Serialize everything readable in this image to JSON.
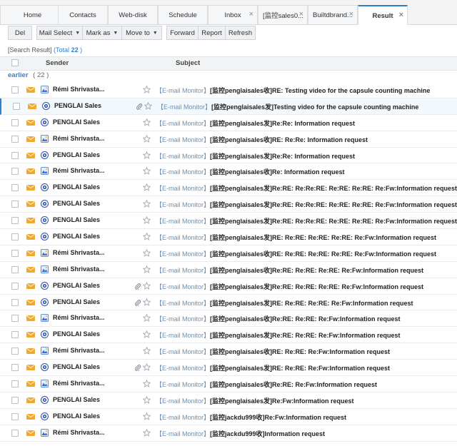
{
  "tabs": [
    {
      "label": "Home",
      "active": false,
      "closable": false
    },
    {
      "label": "Contacts",
      "active": false,
      "closable": false
    },
    {
      "label": "Web-disk",
      "active": false,
      "closable": false
    },
    {
      "label": "Schedule",
      "active": false,
      "closable": false
    },
    {
      "label": "Inbox",
      "active": false,
      "closable": true
    },
    {
      "label": "[监控sales0...",
      "active": false,
      "closable": true
    },
    {
      "label": "Builtdbrand...",
      "active": false,
      "closable": true
    },
    {
      "label": "Result",
      "active": true,
      "closable": true
    }
  ],
  "toolbar": {
    "del": "Del",
    "mail_select": "Mail Select",
    "mark_as": "Mark as",
    "move_to": "Move to",
    "forward": "Forward",
    "report": "Report",
    "refresh": "Refresh"
  },
  "search": {
    "label": "[Search Result]",
    "total_label": "Total",
    "total": "22"
  },
  "columns": {
    "sender": "Sender",
    "subject": "Subject"
  },
  "group": {
    "label": "earlier",
    "count": "( 22 )"
  },
  "monitor_tag": "【E-mail Monitor】",
  "colors": {
    "accent": "#2f7fd1",
    "envelope": "#f0a830",
    "remi_avatar": "#3b6fd8",
    "penglai_avatar": "#2a4fa8"
  },
  "emails": [
    {
      "sender": "Rémi Shrivasta...",
      "avatar": "remi",
      "attach": false,
      "selected": false,
      "subject": "[监控penglaisales收]RE: Testing video for the capsule counting machine"
    },
    {
      "sender": "PENGLAI Sales",
      "avatar": "penglai",
      "attach": true,
      "selected": true,
      "subject": "[监控penglaisales发]Testing video for the capsule counting machine"
    },
    {
      "sender": "PENGLAI Sales",
      "avatar": "penglai",
      "attach": false,
      "selected": false,
      "subject": "[监控penglaisales发]Re:Re: Information request"
    },
    {
      "sender": "Rémi Shrivasta...",
      "avatar": "remi",
      "attach": false,
      "selected": false,
      "subject": "[监控penglaisales收]RE: Re:Re: Information request"
    },
    {
      "sender": "PENGLAI Sales",
      "avatar": "penglai",
      "attach": false,
      "selected": false,
      "subject": "[监控penglaisales发]Re:Re: Information request"
    },
    {
      "sender": "Rémi Shrivasta...",
      "avatar": "remi",
      "attach": false,
      "selected": false,
      "subject": "[监控penglaisales收]Re: Information request"
    },
    {
      "sender": "PENGLAI Sales",
      "avatar": "penglai",
      "attach": false,
      "selected": false,
      "subject": "[监控penglaisales发]Re:RE: Re:Re:RE: Re:RE: Re:RE: Re:Fw:Information request"
    },
    {
      "sender": "PENGLAI Sales",
      "avatar": "penglai",
      "attach": false,
      "selected": false,
      "subject": "[监控penglaisales发]Re:RE: Re:Re:RE: Re:RE: Re:RE: Re:Fw:Information request"
    },
    {
      "sender": "PENGLAI Sales",
      "avatar": "penglai",
      "attach": false,
      "selected": false,
      "subject": "[监控penglaisales发]Re:RE: Re:Re:RE: Re:RE: Re:RE: Re:Fw:Information request"
    },
    {
      "sender": "PENGLAI Sales",
      "avatar": "penglai",
      "attach": false,
      "selected": false,
      "subject": "[监控penglaisales发]RE: Re:RE: Re:RE: Re:RE: Re:Fw:Information request"
    },
    {
      "sender": "Rémi Shrivasta...",
      "avatar": "remi",
      "attach": false,
      "selected": false,
      "subject": "[监控penglaisales收]RE: Re:RE: Re:RE: Re:RE: Re:Fw:Information request"
    },
    {
      "sender": "Rémi Shrivasta...",
      "avatar": "remi",
      "attach": false,
      "selected": false,
      "subject": "[监控penglaisales收]Re:RE: Re:RE: Re:RE: Re:Fw:Information request"
    },
    {
      "sender": "PENGLAI Sales",
      "avatar": "penglai",
      "attach": true,
      "selected": false,
      "subject": "[监控penglaisales发]Re:RE: Re:RE: Re:RE: Re:Fw:Information request"
    },
    {
      "sender": "PENGLAI Sales",
      "avatar": "penglai",
      "attach": true,
      "selected": false,
      "subject": "[监控penglaisales发]RE: Re:RE: Re:RE: Re:Fw:Information request"
    },
    {
      "sender": "Rémi Shrivasta...",
      "avatar": "remi",
      "attach": false,
      "selected": false,
      "subject": "[监控penglaisales收]Re:RE: Re:RE: Re:Fw:Information request"
    },
    {
      "sender": "PENGLAI Sales",
      "avatar": "penglai",
      "attach": false,
      "selected": false,
      "subject": "[监控penglaisales发]Re:RE: Re:RE: Re:Fw:Information request"
    },
    {
      "sender": "Rémi Shrivasta...",
      "avatar": "remi",
      "attach": false,
      "selected": false,
      "subject": "[监控penglaisales收]RE: Re:RE: Re:Fw:Information request"
    },
    {
      "sender": "PENGLAI Sales",
      "avatar": "penglai",
      "attach": true,
      "selected": false,
      "subject": "[监控penglaisales发]RE: Re:RE: Re:Fw:Information request"
    },
    {
      "sender": "Rémi Shrivasta...",
      "avatar": "remi",
      "attach": false,
      "selected": false,
      "subject": "[监控penglaisales收]Re:RE: Re:Fw:Information request"
    },
    {
      "sender": "PENGLAI Sales",
      "avatar": "penglai",
      "attach": false,
      "selected": false,
      "subject": "[监控penglaisales发]Re:Fw:Information request"
    },
    {
      "sender": "PENGLAI Sales",
      "avatar": "penglai",
      "attach": false,
      "selected": false,
      "subject": "[监控jackdu999收]Re:Fw:Information request"
    },
    {
      "sender": "Rémi Shrivasta...",
      "avatar": "remi",
      "attach": false,
      "selected": false,
      "subject": "[监控jackdu999收]Information request"
    }
  ]
}
